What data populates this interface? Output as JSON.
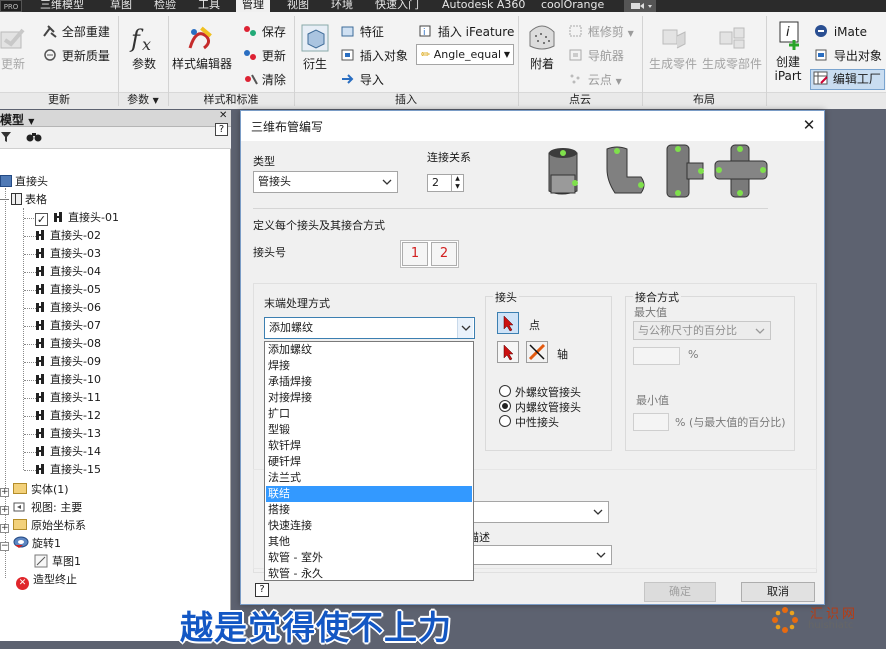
{
  "tabbar": {
    "badge": "PRO",
    "tabs": [
      "三维模型",
      "草图",
      "检验",
      "工具",
      "管理",
      "视图",
      "环境",
      "快速入门",
      "Autodesk A360",
      "coolOrange"
    ],
    "active_tab": "管理"
  },
  "ribbon": {
    "update_group": {
      "label": "更新",
      "big_button": "更新",
      "rebuild_all": "全部重建",
      "update_mass": "更新质量"
    },
    "params_group": {
      "label": "参数",
      "button": "参数",
      "icon": "fx-icon"
    },
    "styles_group": {
      "label": "样式和标准",
      "editor": "样式编辑器",
      "save": "保存",
      "update": "更新",
      "purge": "清除"
    },
    "insert_group": {
      "label": "插入",
      "derive": "衍生",
      "feature": "特征",
      "insert_object": "插入对象",
      "import": "导入",
      "ifeature": "插入 iFeature",
      "angle_combo": "Angle_equal"
    },
    "pointcloud_group": {
      "label": "点云",
      "attach": "附着",
      "crop": "框修剪",
      "navigator": "导航器",
      "cloud_point": "云点"
    },
    "layout_group": {
      "label": "布局",
      "make_part": "生成零件",
      "make_components": "生成零部件"
    },
    "author_group": {
      "create_ipart_1": "创建",
      "create_ipart_2": "iPart",
      "imate": "iMate",
      "export_object": "导出对象",
      "edit_factory": "编辑工厂"
    }
  },
  "browser": {
    "title": "模型",
    "help": "?",
    "tree": {
      "root": "直接头",
      "table": "表格",
      "members": [
        "直接头-01",
        "直接头-02",
        "直接头-03",
        "直接头-04",
        "直接头-05",
        "直接头-06",
        "直接头-07",
        "直接头-08",
        "直接头-09",
        "直接头-10",
        "直接头-11",
        "直接头-12",
        "直接头-13",
        "直接头-14",
        "直接头-15"
      ],
      "solid": "实体(1)",
      "view": "视图: 主要",
      "origin": "原始坐标系",
      "revolve": "旋转1",
      "sketch": "草图1",
      "end_of_part": "造型终止"
    }
  },
  "dialog": {
    "title": "三维布管编写",
    "close": "✕",
    "type_label": "类型",
    "type_value": "管接头",
    "conn_label": "连接关系",
    "conn_value": "2",
    "define_label": "定义每个接头及其接合方式",
    "connector_num_label": "接头号",
    "connector_1": "1",
    "connector_2": "2",
    "end_treatment_label": "末端处理方式",
    "end_treatment_value": "添加螺纹",
    "end_treatment_options": [
      "添加螺纹",
      "焊接",
      "承插焊接",
      "对接焊接",
      "扩口",
      "型锻",
      "软钎焊",
      "硬钎焊",
      "法兰式",
      "联结",
      "搭接",
      "快速连接",
      "其他",
      "软管 - 室外",
      "软管 - 永久"
    ],
    "end_treatment_highlight": "联结",
    "connector_group_label": "接头",
    "point_label": "点",
    "axis_label": "轴",
    "radio_male": "外螺纹管接头",
    "radio_female": "内螺纹管接头",
    "radio_neutral": "中性接头",
    "radio_selected": "内螺纹管接头",
    "engagement_label": "接合方式",
    "max_label": "最大值",
    "engagement_combo": "与公称尺寸的百分比",
    "pct1": "%",
    "min_label": "最小值",
    "pct2": "% (与最大值的百分比)",
    "desc_label": "描述",
    "ok": "确定",
    "cancel": "取消",
    "help": "?"
  },
  "caption": "越是觉得使不上力",
  "watermark": {
    "cn": "汇识网",
    "en": "huishiatc"
  },
  "colors": {
    "accent": "#3399ff",
    "caption": "#1357c4",
    "connector_num": "#d21f1f"
  }
}
